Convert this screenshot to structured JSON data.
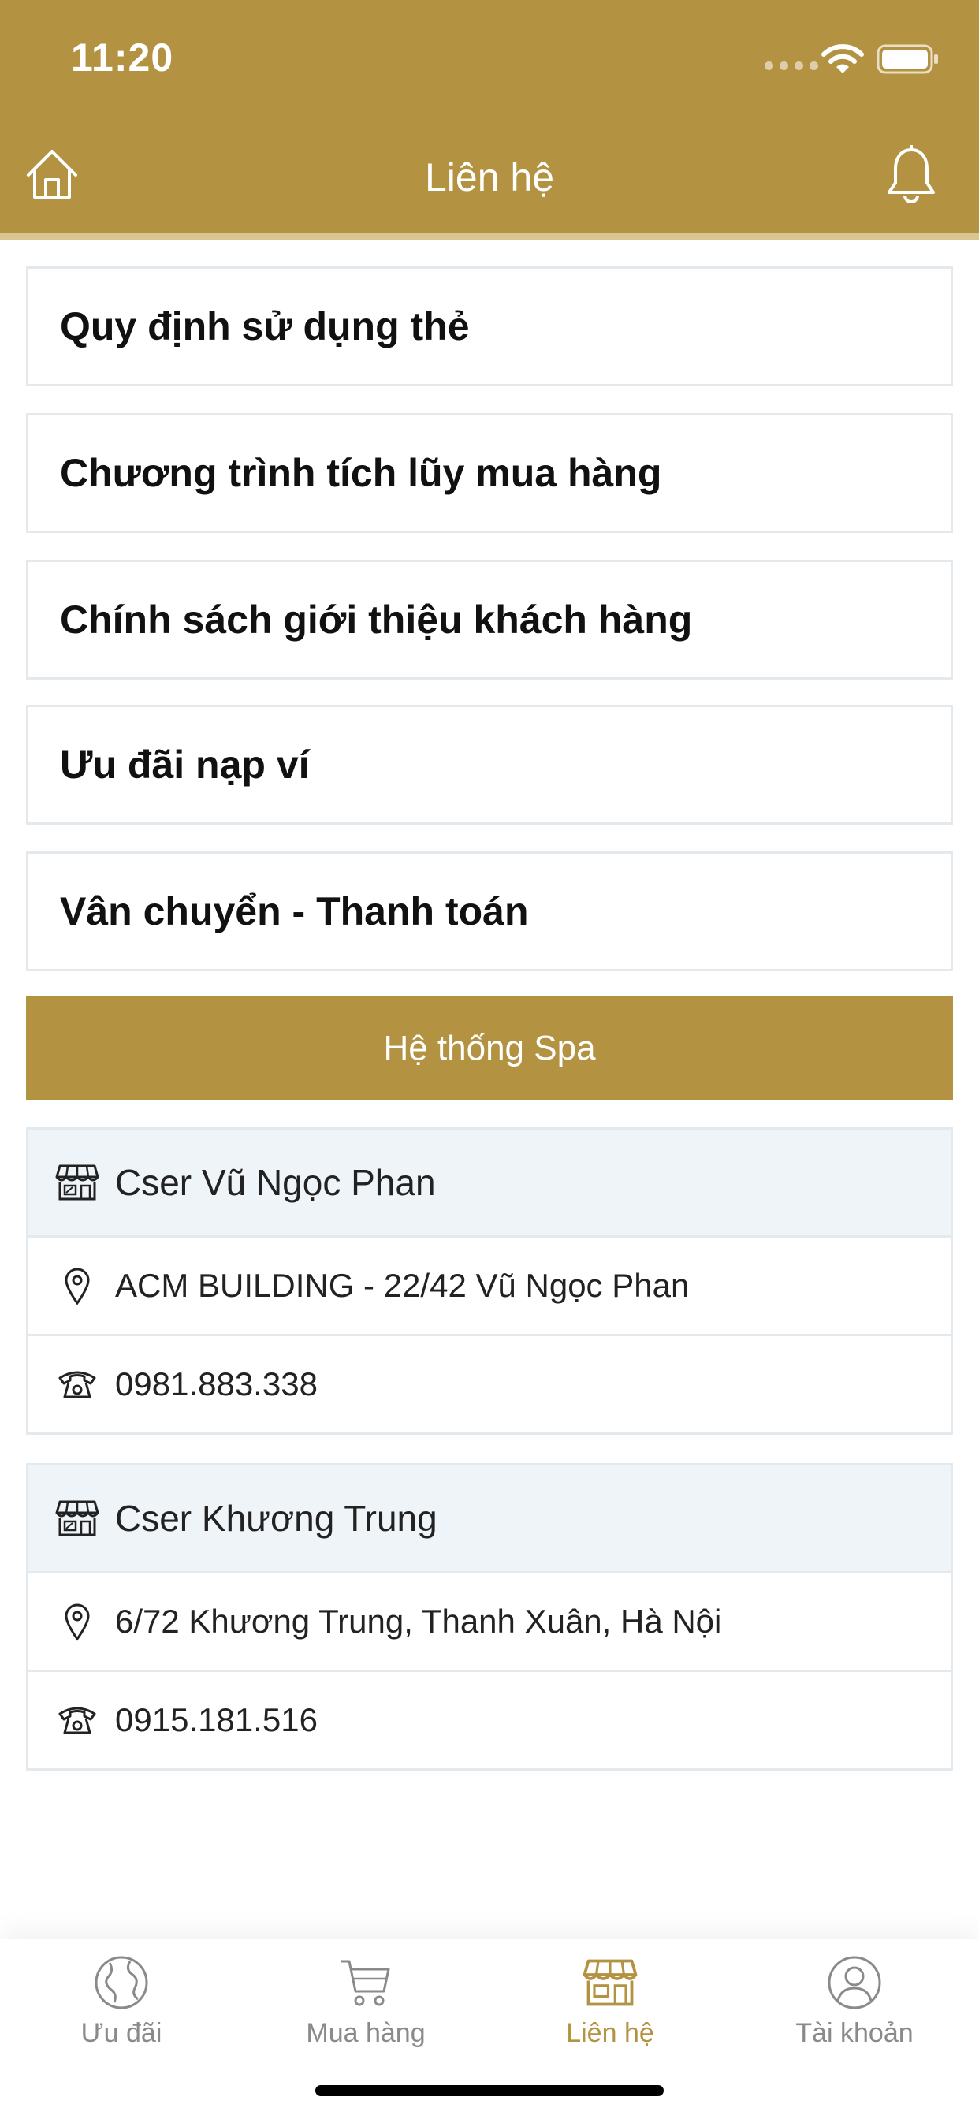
{
  "status_bar": {
    "time": "11:20"
  },
  "header": {
    "title": "Liên hệ"
  },
  "menu": [
    {
      "label": "Quy định sử dụng thẻ"
    },
    {
      "label": "Chương trình tích lũy mua hàng"
    },
    {
      "label": "Chính sách giới thiệu khách hàng"
    },
    {
      "label": "Ưu đãi nạp ví"
    },
    {
      "label": "Vân chuyển - Thanh toán"
    }
  ],
  "spa_section": {
    "title": "Hệ thống Spa"
  },
  "spas": [
    {
      "name": "Cser Vũ Ngọc Phan",
      "address": "ACM BUILDING - 22/42 Vũ Ngọc Phan",
      "phone": "0981.883.338"
    },
    {
      "name": "Cser Khương Trung",
      "address": "6/72 Khương Trung, Thanh Xuân, Hà Nội",
      "phone": "0915.181.516"
    }
  ],
  "tabs": [
    {
      "label": "Ưu đãi",
      "icon": "globe-icon",
      "active": false
    },
    {
      "label": "Mua hàng",
      "icon": "cart-icon",
      "active": false
    },
    {
      "label": "Liên hệ",
      "icon": "store-icon",
      "active": true
    },
    {
      "label": "Tài khoản",
      "icon": "user-icon",
      "active": false
    }
  ],
  "colors": {
    "brand": "#b39342",
    "active_tab": "#b39342",
    "inactive_tab": "#8a8a8a",
    "card_border": "#e3e9ec",
    "spa_name_bg": "#eff4f8"
  }
}
